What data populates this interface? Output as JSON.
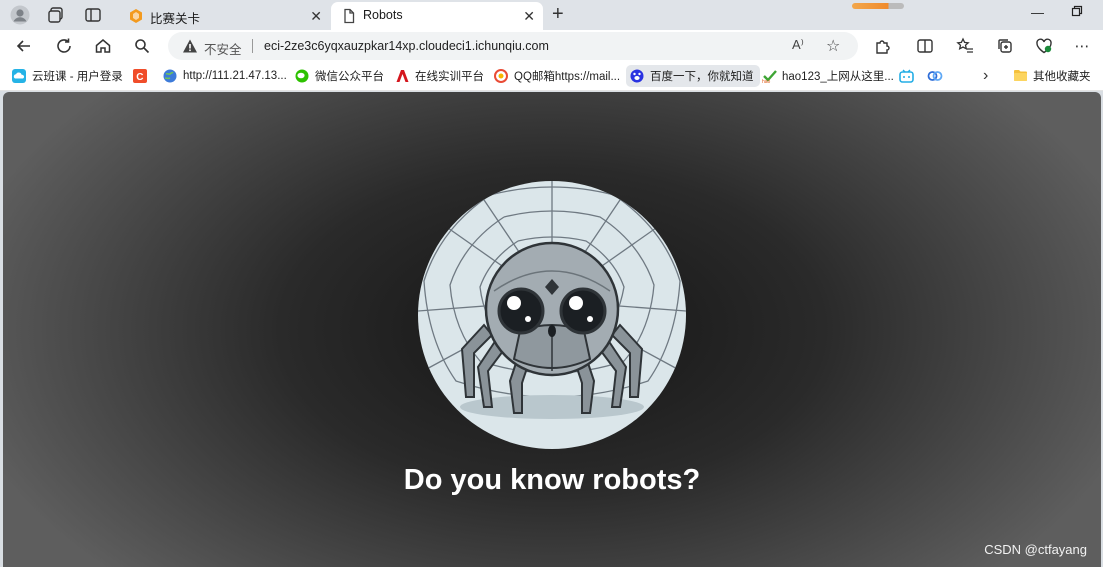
{
  "tabs": [
    {
      "title": "比赛关卡",
      "active": false,
      "icon": "orange-hexagon-icon"
    },
    {
      "title": "Robots",
      "active": true,
      "icon": "document-icon"
    }
  ],
  "address_bar": {
    "security_label": "不安全",
    "url": "eci-2ze3c6yqxauzpkar14xp.cloudeci1.ichunqiu.com",
    "read_aloud_label": "A⁾"
  },
  "bookmarks": [
    {
      "label": "云班课 - 用户登录",
      "icon": "cloud-class-icon"
    },
    {
      "label": "",
      "icon": "c-logo-icon"
    },
    {
      "label": "http://111.21.47.13...",
      "icon": "globe-icon"
    },
    {
      "label": "微信公众平台",
      "icon": "wechat-icon"
    },
    {
      "label": "在线实训平台",
      "icon": "red-a-icon"
    },
    {
      "label": "QQ邮箱https://mail...",
      "icon": "qq-mail-icon"
    },
    {
      "label": "百度一下，你就知道",
      "icon": "baidu-paw-icon"
    },
    {
      "label": "hao123_上网从这里...",
      "icon": "hao123-icon"
    },
    {
      "label": "",
      "icon": "bilibili-icon"
    },
    {
      "label": "",
      "icon": "link-icon"
    },
    {
      "label": "其他收藏夹",
      "icon": "folder-icon"
    }
  ],
  "page": {
    "headline": "Do you know robots?",
    "watermark": "CSDN @ctfayang"
  },
  "colors": {
    "content_dark": "#151515",
    "tab_strip": "#dfe3e8",
    "progress": "#f08a2c"
  }
}
